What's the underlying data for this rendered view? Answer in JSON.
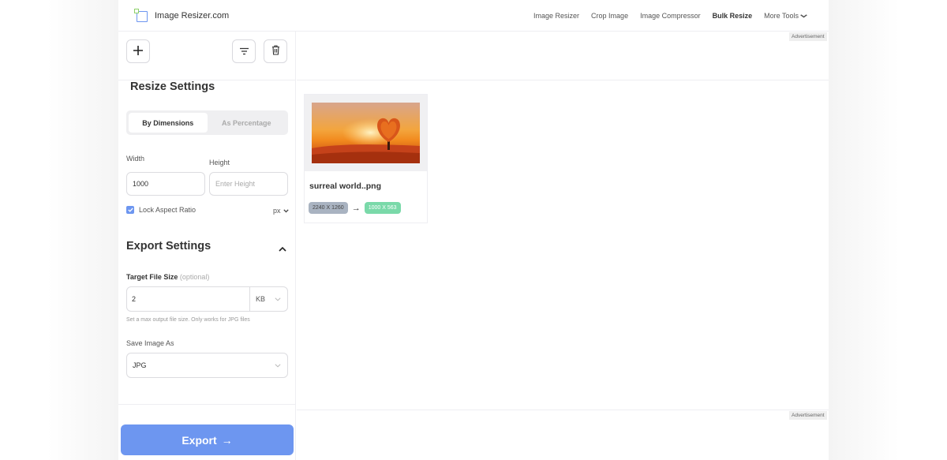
{
  "header": {
    "logo_text": "Image Resizer.com",
    "nav": [
      {
        "label": "Image Resizer",
        "active": false
      },
      {
        "label": "Crop Image",
        "active": false
      },
      {
        "label": "Image Compressor",
        "active": false
      },
      {
        "label": "Bulk Resize",
        "active": true
      },
      {
        "label": "More Tools",
        "active": false
      }
    ]
  },
  "toolbar": {
    "add_icon": "plus-icon",
    "filter_icon": "filter-icon",
    "delete_icon": "trash-icon"
  },
  "resize_settings": {
    "title": "Resize Settings",
    "tabs": [
      {
        "label": "By Dimensions",
        "active": true
      },
      {
        "label": "As Percentage",
        "active": false
      }
    ],
    "width_label": "Width",
    "width_value": "1000",
    "height_label": "Height",
    "height_placeholder": "Enter Height",
    "lock_aspect_label": "Lock Aspect Ratio",
    "lock_aspect_checked": true,
    "unit": "px"
  },
  "export_settings": {
    "title": "Export Settings",
    "target_size_label": "Target File Size",
    "target_size_optional": "(optional)",
    "target_size_value": "2",
    "target_size_unit": "KB",
    "target_size_hint": "Set a max output file size. Only works for JPG files",
    "save_as_label": "Save Image As",
    "save_as_value": "JPG"
  },
  "export_button": {
    "label": "Export",
    "arrow": "→"
  },
  "advertisement_label": "Advertisement",
  "files": [
    {
      "name": "surreal world..png",
      "original_dims": "2240 X 1260",
      "new_dims": "1000 X 563",
      "arrow": "→"
    }
  ],
  "colors": {
    "accent": "#6d96f0",
    "success_badge": "#7ad9a9",
    "original_badge": "#a9b3c1"
  }
}
